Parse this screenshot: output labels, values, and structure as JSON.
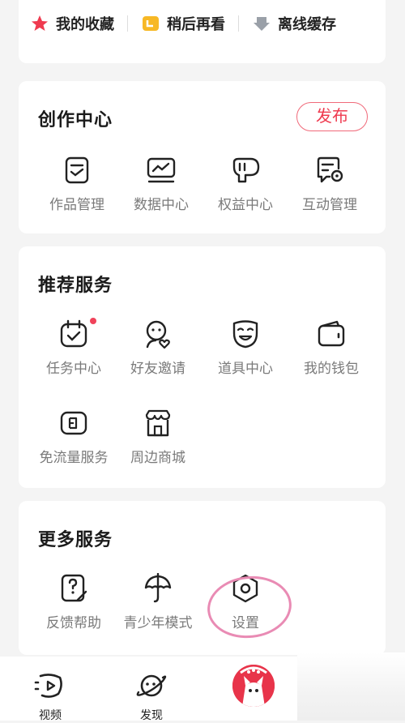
{
  "quick_links": [
    {
      "label": "我的收藏",
      "icon": "star-icon"
    },
    {
      "label": "稍后再看",
      "icon": "later-icon"
    },
    {
      "label": "离线缓存",
      "icon": "download-icon"
    }
  ],
  "creation": {
    "title": "创作中心",
    "publish_label": "发布",
    "items": [
      {
        "label": "作品管理",
        "icon": "works-manage-icon"
      },
      {
        "label": "数据中心",
        "icon": "data-center-icon"
      },
      {
        "label": "权益中心",
        "icon": "benefits-icon"
      },
      {
        "label": "互动管理",
        "icon": "interaction-manage-icon"
      }
    ]
  },
  "recommended": {
    "title": "推荐服务",
    "items": [
      {
        "label": "任务中心",
        "icon": "task-center-icon",
        "has_dot": true
      },
      {
        "label": "好友邀请",
        "icon": "invite-friend-icon"
      },
      {
        "label": "道具中心",
        "icon": "props-mask-icon"
      },
      {
        "label": "我的钱包",
        "icon": "wallet-icon"
      },
      {
        "label": "免流量服务",
        "icon": "free-data-icon"
      },
      {
        "label": "周边商城",
        "icon": "store-icon"
      }
    ]
  },
  "more": {
    "title": "更多服务",
    "items": [
      {
        "label": "反馈帮助",
        "icon": "feedback-help-icon"
      },
      {
        "label": "青少年模式",
        "icon": "umbrella-icon"
      },
      {
        "label": "设置",
        "icon": "settings-hexagon-icon"
      }
    ]
  },
  "tabbar": {
    "items": [
      {
        "label": "视频",
        "icon": "video-tab-icon"
      },
      {
        "label": "发现",
        "icon": "discover-planet-icon"
      }
    ]
  },
  "colors": {
    "accent": "#ef3a4f",
    "highlight_ring": "#e98bb4",
    "label_gray": "#7a7a7a",
    "background": "#f4f4f4"
  }
}
